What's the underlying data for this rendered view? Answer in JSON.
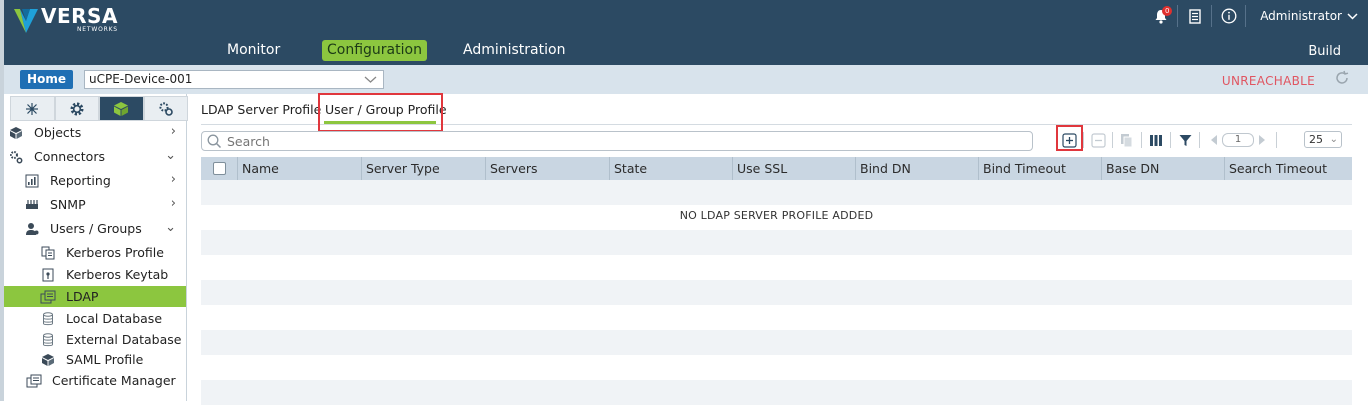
{
  "brand": {
    "name": "VERSA",
    "sub": "NETWORKS"
  },
  "header": {
    "bell_count": "0",
    "user": "Administrator",
    "nav": [
      "Monitor",
      "Configuration",
      "Administration"
    ],
    "active_nav": "Configuration",
    "build": "Build"
  },
  "subbar": {
    "home": "Home",
    "device": "uCPE-Device-001",
    "status": "UNREACHABLE",
    "status_color": "#e05561"
  },
  "sidebar": {
    "items": [
      {
        "label": "Objects",
        "icon": "cube-icon"
      },
      {
        "label": "Connectors",
        "icon": "gears-icon"
      },
      {
        "label": "Reporting",
        "icon": "chart-icon"
      },
      {
        "label": "SNMP",
        "icon": "snmp-icon"
      },
      {
        "label": "Users / Groups",
        "icon": "user-icon"
      },
      {
        "label": "Kerberos Profile",
        "icon": "profile-icon"
      },
      {
        "label": "Kerberos Keytab",
        "icon": "keytab-icon"
      },
      {
        "label": "LDAP",
        "icon": "ldap-icon"
      },
      {
        "label": "Local Database",
        "icon": "database-icon"
      },
      {
        "label": "External Database",
        "icon": "database-icon"
      },
      {
        "label": "SAML Profile",
        "icon": "saml-icon"
      },
      {
        "label": "Certificate Manager",
        "icon": "certificate-icon"
      }
    ],
    "selected": "LDAP",
    "accent": "#8cc63f"
  },
  "tabs": [
    "LDAP Server Profile",
    "User / Group Profile"
  ],
  "active_tab": "User / Group Profile",
  "search": {
    "placeholder": "Search"
  },
  "pagination": {
    "page": "1",
    "page_size": "25"
  },
  "grid": {
    "columns": [
      "Name",
      "Server Type",
      "Servers",
      "State",
      "Use SSL",
      "Bind DN",
      "Bind Timeout",
      "Base DN",
      "Search Timeout"
    ],
    "empty_message": "NO LDAP SERVER PROFILE ADDED"
  }
}
